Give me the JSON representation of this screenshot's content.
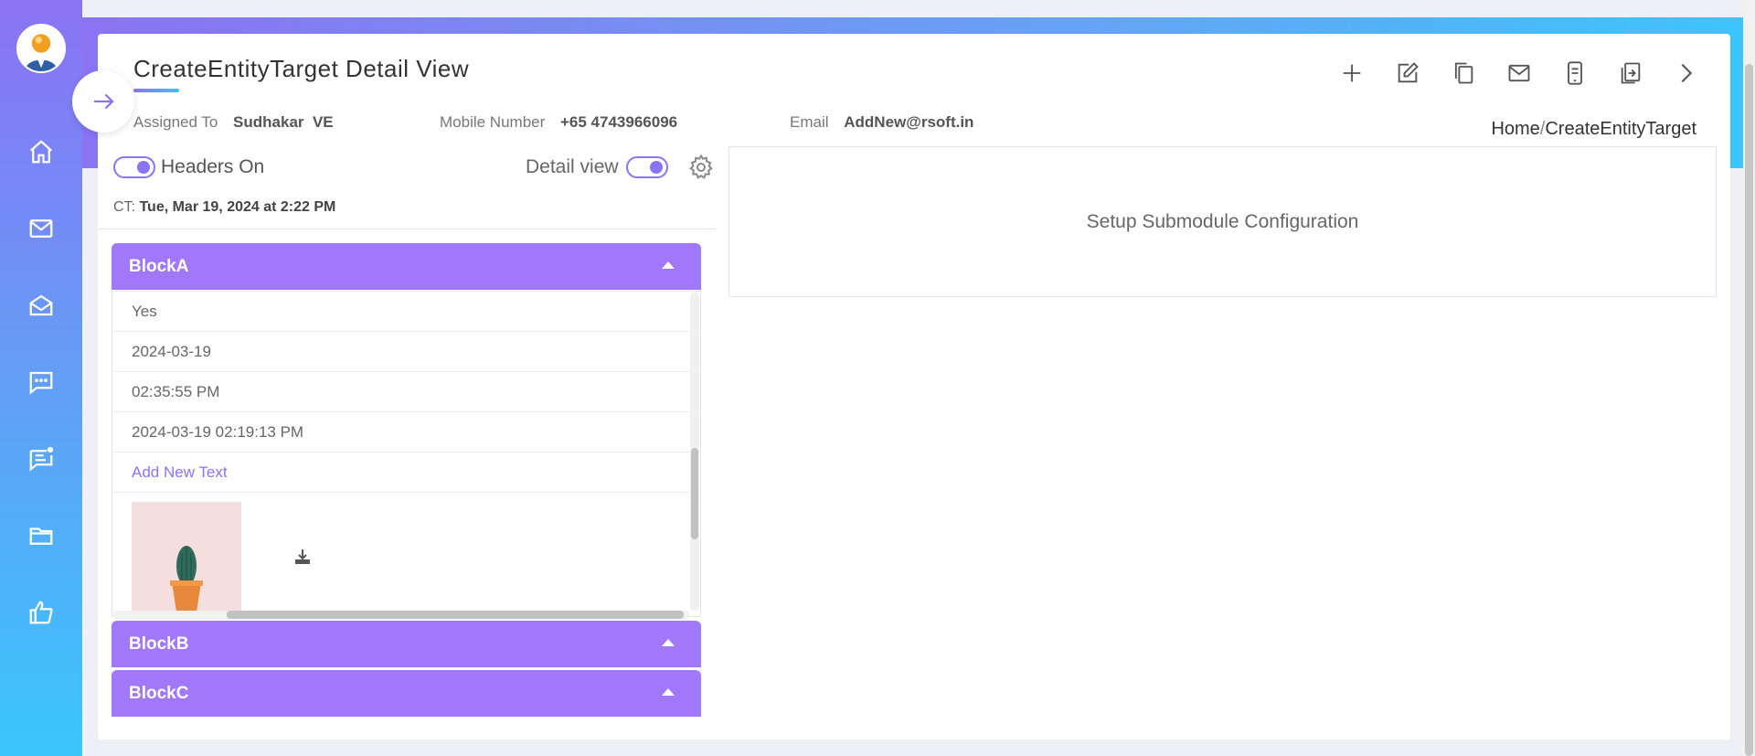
{
  "header": {
    "title": "CreateEntityTarget Detail View",
    "assigned_label": "Assigned To",
    "assigned_value": "Sudhakar  VE",
    "mobile_label": "Mobile Number",
    "mobile_value": "+65 4743966096",
    "email_label": "Email",
    "email_value": "AddNew@rsoft.in"
  },
  "breadcrumb": {
    "home": "Home",
    "separator": "/",
    "current": "CreateEntityTarget"
  },
  "toggles": {
    "headers_label": "Headers On",
    "detail_label": "Detail view"
  },
  "ct": {
    "label": "CT:",
    "value": "Tue, Mar 19, 2024 at 2:22 PM"
  },
  "blocks": {
    "a": {
      "title": "BlockA"
    },
    "b": {
      "title": "BlockB"
    },
    "c": {
      "title": "BlockC"
    }
  },
  "block_a_rows": [
    "Yes",
    "2024-03-19",
    "02:35:55 PM",
    "2024-03-19 02:19:13 PM",
    "Add New Text"
  ],
  "right_panel": {
    "message": "Setup Submodule Configuration"
  },
  "sidebar_icons": [
    "home-icon",
    "mail-icon",
    "open-mail-icon",
    "chat-icon",
    "notification-chat-icon",
    "folder-icon",
    "thumbs-up-icon"
  ],
  "toolbar_icons": [
    "add-icon",
    "edit-icon",
    "copy-icon",
    "mail-icon",
    "mobile-icon",
    "share-document-icon",
    "next-icon"
  ],
  "colors": {
    "accent": "#a278fb",
    "gradient_start": "#8b73f3",
    "gradient_end": "#3ac6fb"
  }
}
